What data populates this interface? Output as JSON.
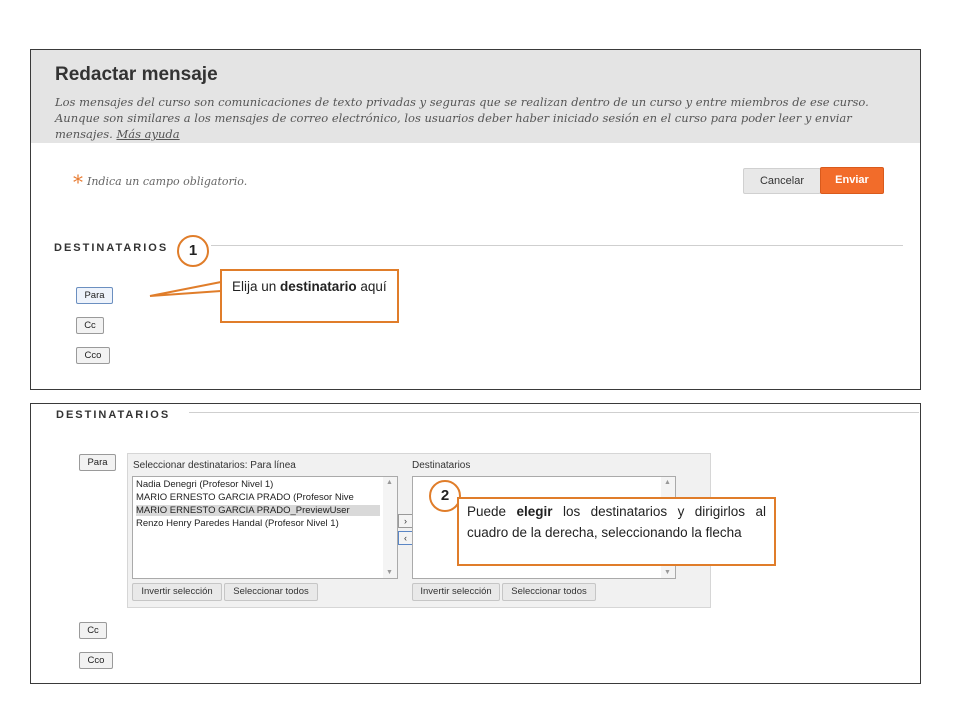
{
  "compose": {
    "title": "Redactar mensaje",
    "description": "Los mensajes del curso son comunicaciones de texto privadas y seguras que se realizan dentro de un curso y entre miembros de ese curso. Aunque son similares a los mensajes de correo electrónico, los usuarios deber haber iniciado sesión en el curso para poder leer y enviar mensajes.",
    "help_link": "Más ayuda",
    "required_star": "*",
    "required_note": "Indica un campo obligatorio.",
    "cancel_label": "Cancelar",
    "send_label": "Enviar"
  },
  "recipients_section": {
    "title": "DESTINATARIOS",
    "to_label": "Para",
    "cc_label": "Cc",
    "bcc_label": "Cco"
  },
  "callout1": {
    "number": "1",
    "text_before": "Elija un",
    "text_bold": "destinatario",
    "text_after": "aquí"
  },
  "selector": {
    "left_label": "Seleccionar destinatarios: Para línea",
    "right_label": "Destinatarios",
    "users": [
      {
        "name": "Nadia Denegri (Profesor Nivel 1)",
        "selected": false
      },
      {
        "name": "MARIO ERNESTO GARCIA PRADO (Profesor Nive",
        "selected": false
      },
      {
        "name": "MARIO ERNESTO GARCIA PRADO_PreviewUser",
        "selected": true
      },
      {
        "name": "Renzo Henry Paredes Handal (Profesor Nivel 1)",
        "selected": false
      }
    ],
    "invert_label": "Invertir selección",
    "select_all_label": "Seleccionar todos",
    "move_right": "›",
    "move_left": "‹",
    "scroll_up": "▲",
    "scroll_down": "▼"
  },
  "callout2": {
    "number": "2",
    "text_before": "Puede",
    "text_bold": "elegir",
    "text_after": "los destinatarios y dirigirlos al cuadro de la derecha, seleccionando la flecha"
  },
  "colors": {
    "accent": "#e07d2a",
    "send_button": "#f26c2a",
    "header_bg": "#e4e4e4"
  }
}
